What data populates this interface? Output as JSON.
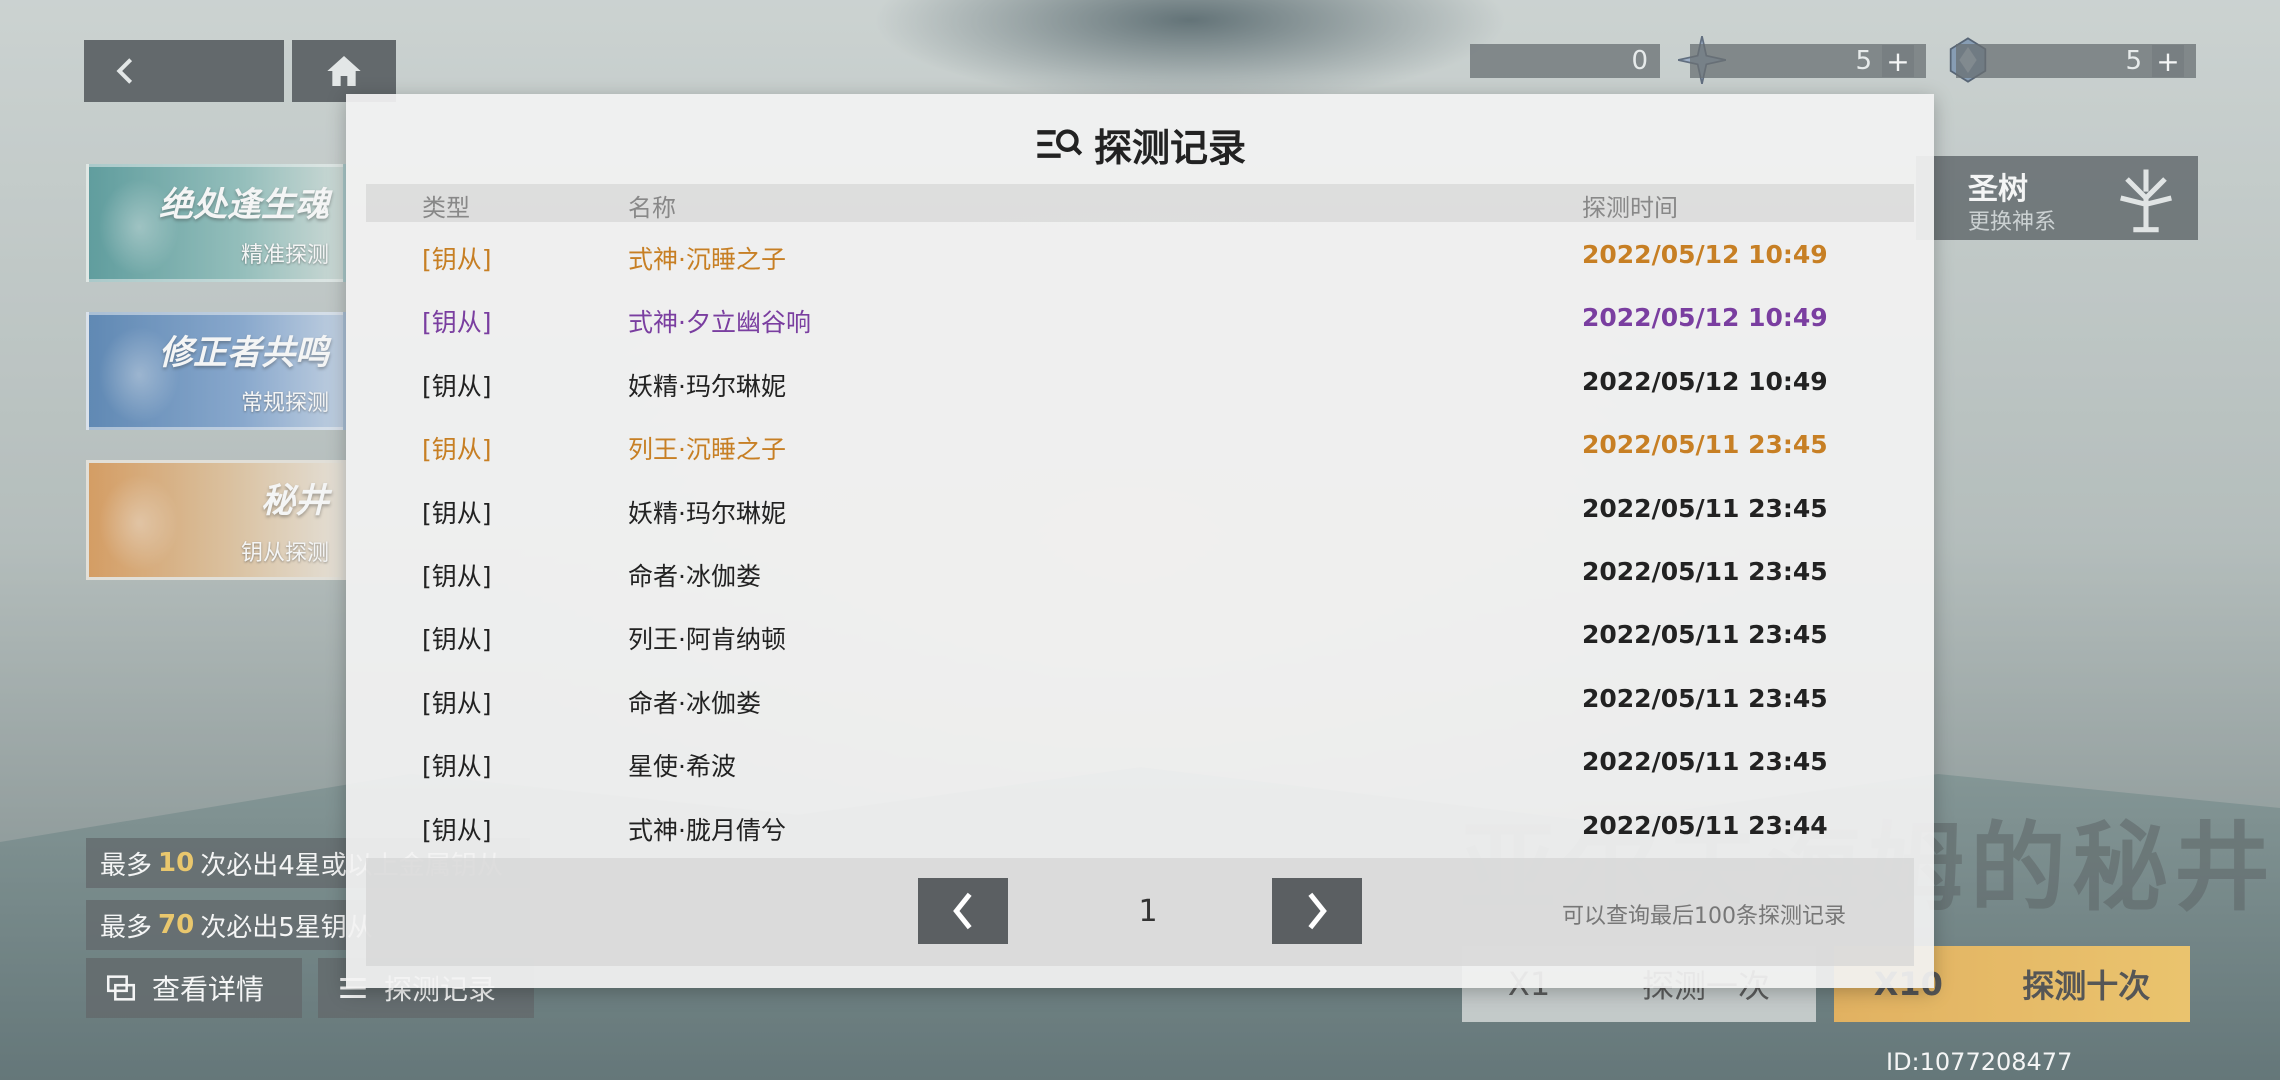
{
  "top_bar": {
    "currency_1": "0",
    "currency_2": "5",
    "currency_3": "5",
    "plus": "+"
  },
  "banners": [
    {
      "title": "绝处逢生魂",
      "subtitle": "精准探测"
    },
    {
      "title": "修正者共鸣",
      "subtitle": "常规探测"
    },
    {
      "title": "秘井",
      "subtitle": "钥从探测"
    }
  ],
  "tree_panel": {
    "title": "圣树",
    "subtitle": "更换神系"
  },
  "rules": [
    {
      "prefix": "最多",
      "count": "10",
      "suffix": "次必出4星或以上金属钥从"
    },
    {
      "prefix": "最多",
      "count": "70",
      "suffix": "次必出5星钥从"
    }
  ],
  "buttons": {
    "detail": "查看详情",
    "record": "探测记录"
  },
  "pool_title": "亚尔夫海姆的秘井",
  "draw": {
    "single_count": "X1",
    "single_label": "探测一次",
    "ten_count": "X10",
    "ten_label": "探测十次"
  },
  "uid": "ID:1077208477",
  "modal": {
    "title": "探测记录",
    "columns": {
      "type": "类型",
      "name": "名称",
      "time": "探测时间"
    },
    "rows": [
      {
        "type": "[钥从]",
        "name": "式神·沉睡之子",
        "time": "2022/05/12 10:49",
        "color": "#c77f24"
      },
      {
        "type": "[钥从]",
        "name": "式神·夕立幽谷响",
        "time": "2022/05/12 10:49",
        "color": "#7a3ea0"
      },
      {
        "type": "[钥从]",
        "name": "妖精·玛尔琳妮",
        "time": "2022/05/12 10:49",
        "color": "#222222"
      },
      {
        "type": "[钥从]",
        "name": "列王·沉睡之子",
        "time": "2022/05/11 23:45",
        "color": "#c77f24"
      },
      {
        "type": "[钥从]",
        "name": "妖精·玛尔琳妮",
        "time": "2022/05/11 23:45",
        "color": "#222222"
      },
      {
        "type": "[钥从]",
        "name": "命者·冰伽娄",
        "time": "2022/05/11 23:45",
        "color": "#222222"
      },
      {
        "type": "[钥从]",
        "name": "列王·阿肯纳顿",
        "time": "2022/05/11 23:45",
        "color": "#222222"
      },
      {
        "type": "[钥从]",
        "name": "命者·冰伽娄",
        "time": "2022/05/11 23:45",
        "color": "#222222"
      },
      {
        "type": "[钥从]",
        "name": "星使·希波",
        "time": "2022/05/11 23:45",
        "color": "#222222"
      },
      {
        "type": "[钥从]",
        "name": "式神·胧月倩兮",
        "time": "2022/05/11 23:44",
        "color": "#222222"
      }
    ],
    "page": "1",
    "hint": "可以查询最后100条探测记录"
  },
  "icons": {
    "back": "chevron-left-icon",
    "home": "home-icon",
    "search_list": "list-search-icon",
    "prev": "chevron-left-icon",
    "next": "chevron-right-icon"
  }
}
